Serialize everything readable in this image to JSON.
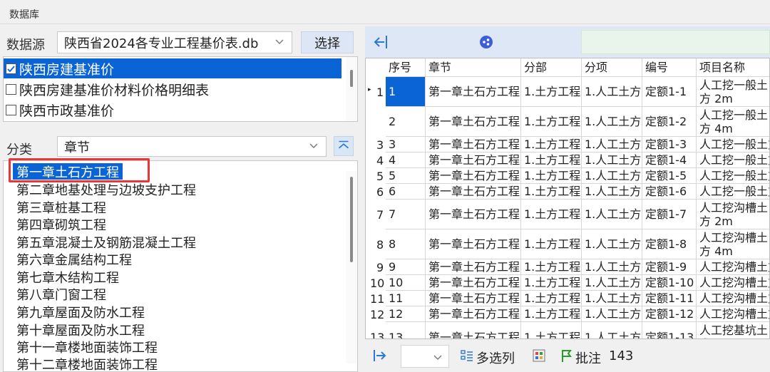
{
  "window": {
    "title": "数据库"
  },
  "db": {
    "label": "数据源",
    "selected": "陕西省2024各专业工程基价表.db",
    "select_button": "选择",
    "items": [
      {
        "label": "陕西房建基准价",
        "checked": true
      },
      {
        "label": "陕西房建基准价材料价格明细表",
        "checked": false
      },
      {
        "label": "陕西市政基准价",
        "checked": false
      }
    ]
  },
  "classify": {
    "label": "分类",
    "selected": "章节",
    "chapters": [
      "第一章土石方工程",
      "第二章地基处理与边坡支护工程",
      "第三章桩基工程",
      "第四章砌筑工程",
      "第五章混凝土及钢筋混凝土工程",
      "第六章金属结构工程",
      "第七章木结构工程",
      "第八章门窗工程",
      "第九章屋面及防水工程",
      "第十章屋面及防水工程",
      "第十一章楼地面装饰工程",
      "第十二章楼地面装饰工程"
    ]
  },
  "table": {
    "columns": [
      "序号",
      "章节",
      "分部",
      "分项",
      "编号",
      "项目名称"
    ],
    "rows": [
      {
        "ind": "1",
        "seq": "1",
        "chapter": "第一章土石方工程",
        "part": "1.土方工程",
        "item": "1.人工土方",
        "code": "定额1-1",
        "name": "人工挖一般土方 2m"
      },
      {
        "ind": "",
        "seq": "2",
        "chapter": "第一章土石方工程",
        "part": "1.土方工程",
        "item": "1.人工土方",
        "code": "定额1-2",
        "name": "人工挖一般土方 4m"
      },
      {
        "ind": "3",
        "seq": "3",
        "chapter": "第一章土石方工程",
        "part": "1.土方工程",
        "item": "1.人工土方",
        "code": "定额1-3",
        "name": "人工挖一般土方"
      },
      {
        "ind": "4",
        "seq": "4",
        "chapter": "第一章土石方工程",
        "part": "1.土方工程",
        "item": "1.人工土方",
        "code": "定额1-4",
        "name": "人工挖一般土方"
      },
      {
        "ind": "5",
        "seq": "5",
        "chapter": "第一章土石方工程",
        "part": "1.土方工程",
        "item": "1.人工土方",
        "code": "定额1-5",
        "name": "人工挖一般土方"
      },
      {
        "ind": "6",
        "seq": "6",
        "chapter": "第一章土石方工程",
        "part": "1.土方工程",
        "item": "1.人工土方",
        "code": "定额1-6",
        "name": "人工挖一般土方"
      },
      {
        "ind": "7",
        "seq": "7",
        "chapter": "第一章土石方工程",
        "part": "1.土方工程",
        "item": "1.人工土方",
        "code": "定额1-7",
        "name": "人工挖沟槽土方 2m"
      },
      {
        "ind": "8",
        "seq": "8",
        "chapter": "第一章土石方工程",
        "part": "1.土方工程",
        "item": "1.人工土方",
        "code": "定额1-8",
        "name": "人工挖沟槽土方 4m"
      },
      {
        "ind": "9",
        "seq": "9",
        "chapter": "第一章土石方工程",
        "part": "1.土方工程",
        "item": "1.人工土方",
        "code": "定额1-9",
        "name": "人工挖沟槽土方"
      },
      {
        "ind": "10",
        "seq": "10",
        "chapter": "第一章土石方工程",
        "part": "1.土方工程",
        "item": "1.人工土方",
        "code": "定额1-10",
        "name": "人工挖沟槽土方"
      },
      {
        "ind": "11",
        "seq": "11",
        "chapter": "第一章土石方工程",
        "part": "1.土方工程",
        "item": "1.人工土方",
        "code": "定额1-11",
        "name": "人工挖沟槽土方"
      },
      {
        "ind": "12",
        "seq": "12",
        "chapter": "第一章土石方工程",
        "part": "1.土方工程",
        "item": "1.人工土方",
        "code": "定额1-12",
        "name": "人工挖沟槽土方"
      },
      {
        "ind": "13",
        "seq": "13",
        "chapter": "第一章土石方工程",
        "part": "1.土方工程",
        "item": "1.人工土方",
        "code": "定额1-13",
        "name": "人工挖基坑土方"
      }
    ]
  },
  "bottom": {
    "multi_select": "多选列",
    "annotate": "批注",
    "count": "143"
  },
  "colors": {
    "accent": "#0a64d6",
    "highlight_box": "#e8363a",
    "toolbar_bg": "#dde7f5"
  },
  "icons": [
    "collapse-left-icon",
    "share-icon",
    "chevron-down-icon",
    "chevron-up-icon",
    "expand-right-icon",
    "columns-icon",
    "palette-icon",
    "flag-icon"
  ]
}
